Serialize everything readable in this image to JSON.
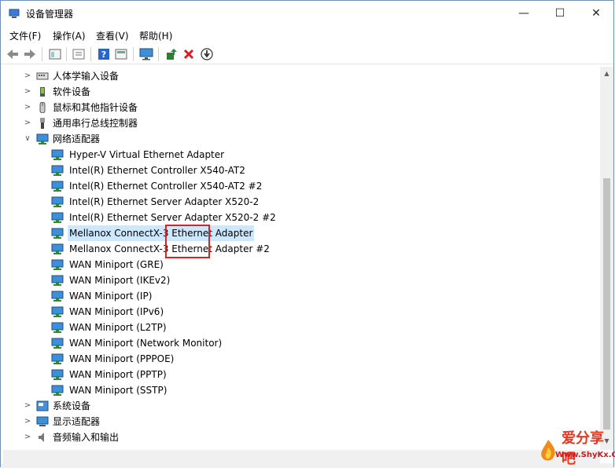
{
  "window": {
    "title": "设备管理器",
    "minimize_glyph": "—",
    "maximize_glyph": "☐",
    "close_glyph": "✕"
  },
  "menu": [
    "文件(F)",
    "操作(A)",
    "查看(V)",
    "帮助(H)"
  ],
  "toolbar": {
    "buttons": [
      "back-icon",
      "forward-icon",
      "properties-icon",
      "list-icon",
      "help-icon",
      "view-icon",
      "monitor-icon",
      "update-driver-icon",
      "uninstall-icon",
      "scan-icon"
    ]
  },
  "tree": {
    "categories_top": [
      {
        "label": "人体学输入设备",
        "icon": "hid-icon"
      },
      {
        "label": "软件设备",
        "icon": "software-device-icon"
      },
      {
        "label": "鼠标和其他指针设备",
        "icon": "mouse-icon"
      },
      {
        "label": "通用串行总线控制器",
        "icon": "usb-icon"
      }
    ],
    "network_category": {
      "label": "网络适配器",
      "icon": "network-adapter-icon",
      "expanded": true
    },
    "network_children": [
      "Hyper-V Virtual Ethernet Adapter",
      "Intel(R) Ethernet Controller X540-AT2",
      "Intel(R) Ethernet Controller X540-AT2 #2",
      "Intel(R) Ethernet Server Adapter X520-2",
      "Intel(R) Ethernet Server Adapter X520-2 #2",
      "Mellanox ConnectX-3 Ethernet Adapter",
      "Mellanox ConnectX-3 Ethernet Adapter #2",
      "WAN Miniport (GRE)",
      "WAN Miniport (IKEv2)",
      "WAN Miniport (IP)",
      "WAN Miniport (IPv6)",
      "WAN Miniport (L2TP)",
      "WAN Miniport (Network Monitor)",
      "WAN Miniport (PPPOE)",
      "WAN Miniport (PPTP)",
      "WAN Miniport (SSTP)"
    ],
    "categories_bottom": [
      {
        "label": "系统设备",
        "icon": "system-device-icon"
      },
      {
        "label": "显示适配器",
        "icon": "display-adapter-icon"
      },
      {
        "label": "音频输入和输出",
        "icon": "audio-icon"
      }
    ],
    "selected_item": "Mellanox ConnectX-3 Ethernet Adapter"
  },
  "watermark": {
    "line1": "爱分享吧",
    "line2": "Www.ShyKx.Com"
  },
  "colors": {
    "selection": "#cce8ff",
    "highlight_box": "#e02020"
  }
}
